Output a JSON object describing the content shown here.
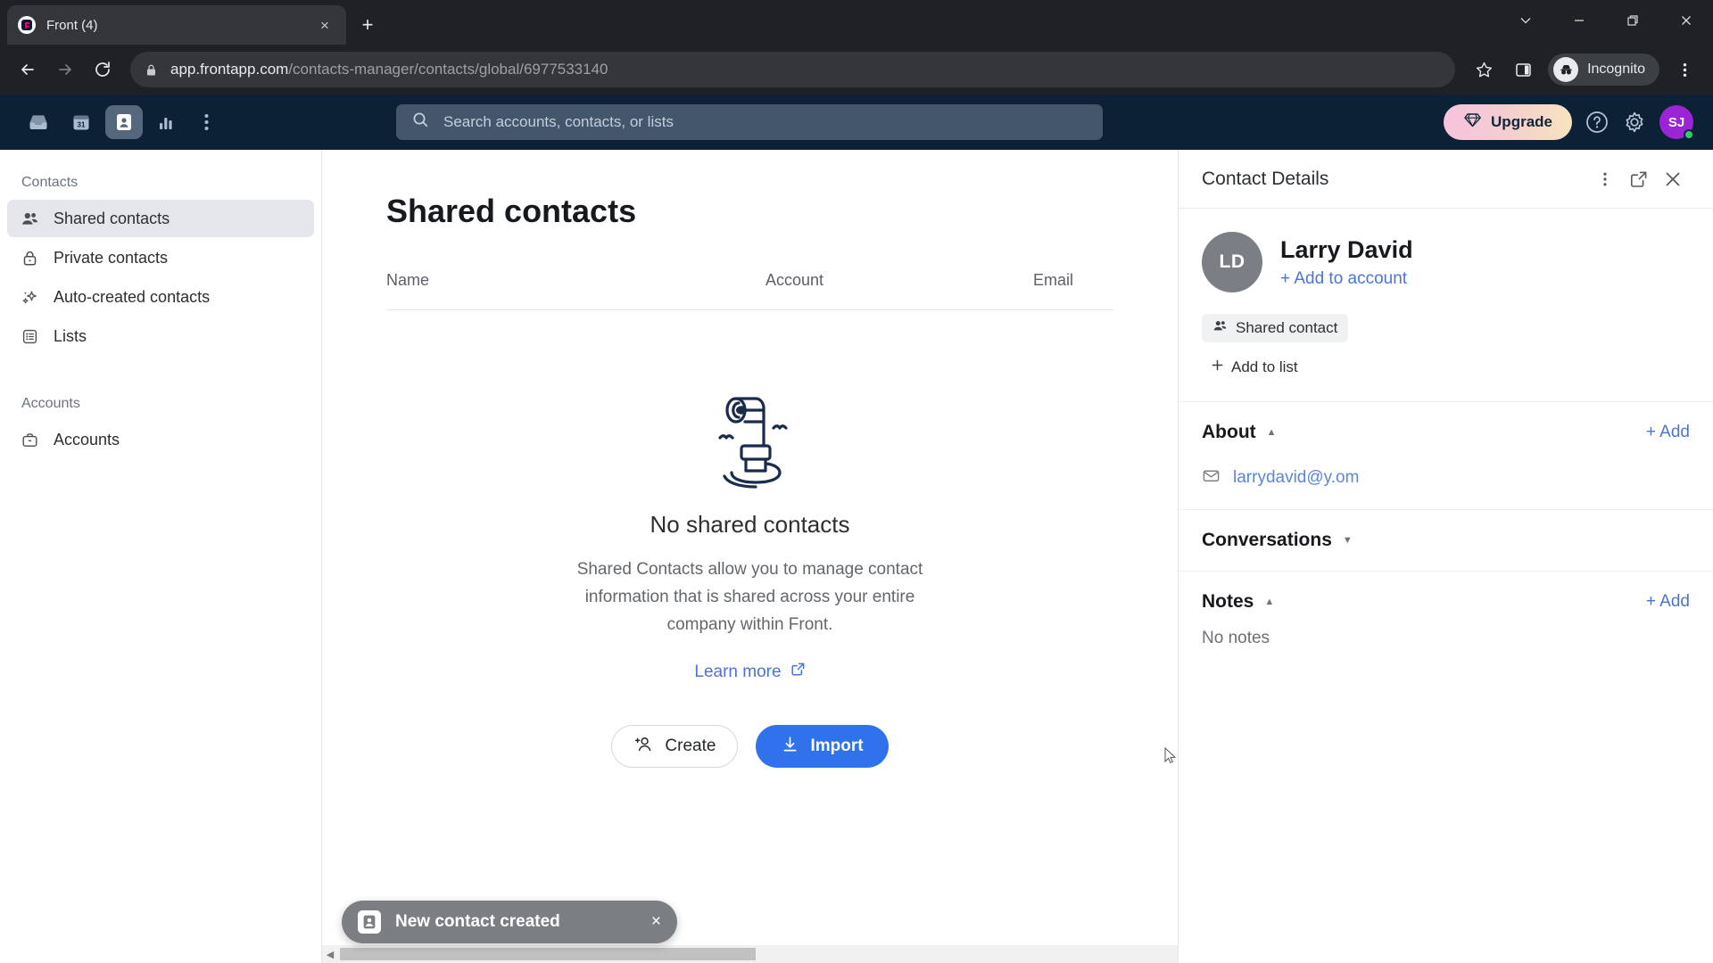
{
  "browser": {
    "tab": {
      "title": "Front (4)",
      "favicon": "front-logo-icon",
      "close": "×"
    },
    "new_tab": "+",
    "window_controls": [
      "chevron-down",
      "minimize",
      "restore",
      "close"
    ],
    "nav": {
      "back": "←",
      "forward": "→",
      "reload": "↻"
    },
    "url_domain": "app.frontapp.com",
    "url_path": "/contacts-manager/contacts/global/6977533140",
    "bookmark": "star-icon",
    "side_panel": "side-panel-icon",
    "profile_label": "Incognito",
    "menu": "kebab-menu-icon"
  },
  "app_header": {
    "nav_items": [
      {
        "name": "inbox",
        "label": "Inbox",
        "active": false
      },
      {
        "name": "calendar",
        "label": "Calendar",
        "active": false
      },
      {
        "name": "contacts",
        "label": "Contacts",
        "active": true
      },
      {
        "name": "analytics",
        "label": "Analytics",
        "active": false
      }
    ],
    "more_label": "More",
    "search_placeholder": "Search accounts, contacts, or lists",
    "upgrade_label": "Upgrade",
    "help_label": "Help",
    "settings_label": "Settings",
    "avatar_initials": "SJ",
    "brand_dark": "#0d2136",
    "accent_blue": "#2f72eb",
    "link_blue": "#4a74d8"
  },
  "sidebar": {
    "groups": [
      {
        "label": "Contacts",
        "items": [
          {
            "label": "Shared contacts",
            "icon": "people-icon",
            "active": true
          },
          {
            "label": "Private contacts",
            "icon": "lock-icon",
            "active": false
          },
          {
            "label": "Auto-created contacts",
            "icon": "sparkles-icon",
            "active": false
          },
          {
            "label": "Lists",
            "icon": "list-icon",
            "active": false
          }
        ]
      },
      {
        "label": "Accounts",
        "items": [
          {
            "label": "Accounts",
            "icon": "briefcase-icon",
            "active": false
          }
        ]
      }
    ]
  },
  "main": {
    "page_title": "Shared contacts",
    "columns": [
      "Name",
      "Account",
      "Email"
    ],
    "empty": {
      "illustration": "periscope-icon",
      "title": "No shared contacts",
      "description": "Shared Contacts allow you to manage contact information that is shared across your entire company within Front.",
      "learn_more": "Learn more",
      "create_label": "Create",
      "import_label": "Import"
    }
  },
  "details": {
    "panel_title": "Contact Details",
    "actions": [
      "kebab-menu-icon",
      "open-external-icon",
      "close-icon"
    ],
    "contact": {
      "initials": "LD",
      "name": "Larry David",
      "add_to_account": "+ Add to account",
      "type_chip": "Shared contact",
      "add_to_list": "Add to list"
    },
    "sections": [
      {
        "title": "About",
        "expanded": true,
        "add_label": "+ Add",
        "rows": [
          {
            "icon": "envelope-icon",
            "value": "larrydavid@y.om"
          }
        ]
      },
      {
        "title": "Conversations",
        "expanded": false,
        "add_label": "",
        "rows": []
      },
      {
        "title": "Notes",
        "expanded": true,
        "add_label": "+ Add",
        "empty_text": "No notes"
      }
    ]
  },
  "toast": {
    "icon": "contact-card-icon",
    "message": "New contact created",
    "close": "×"
  }
}
